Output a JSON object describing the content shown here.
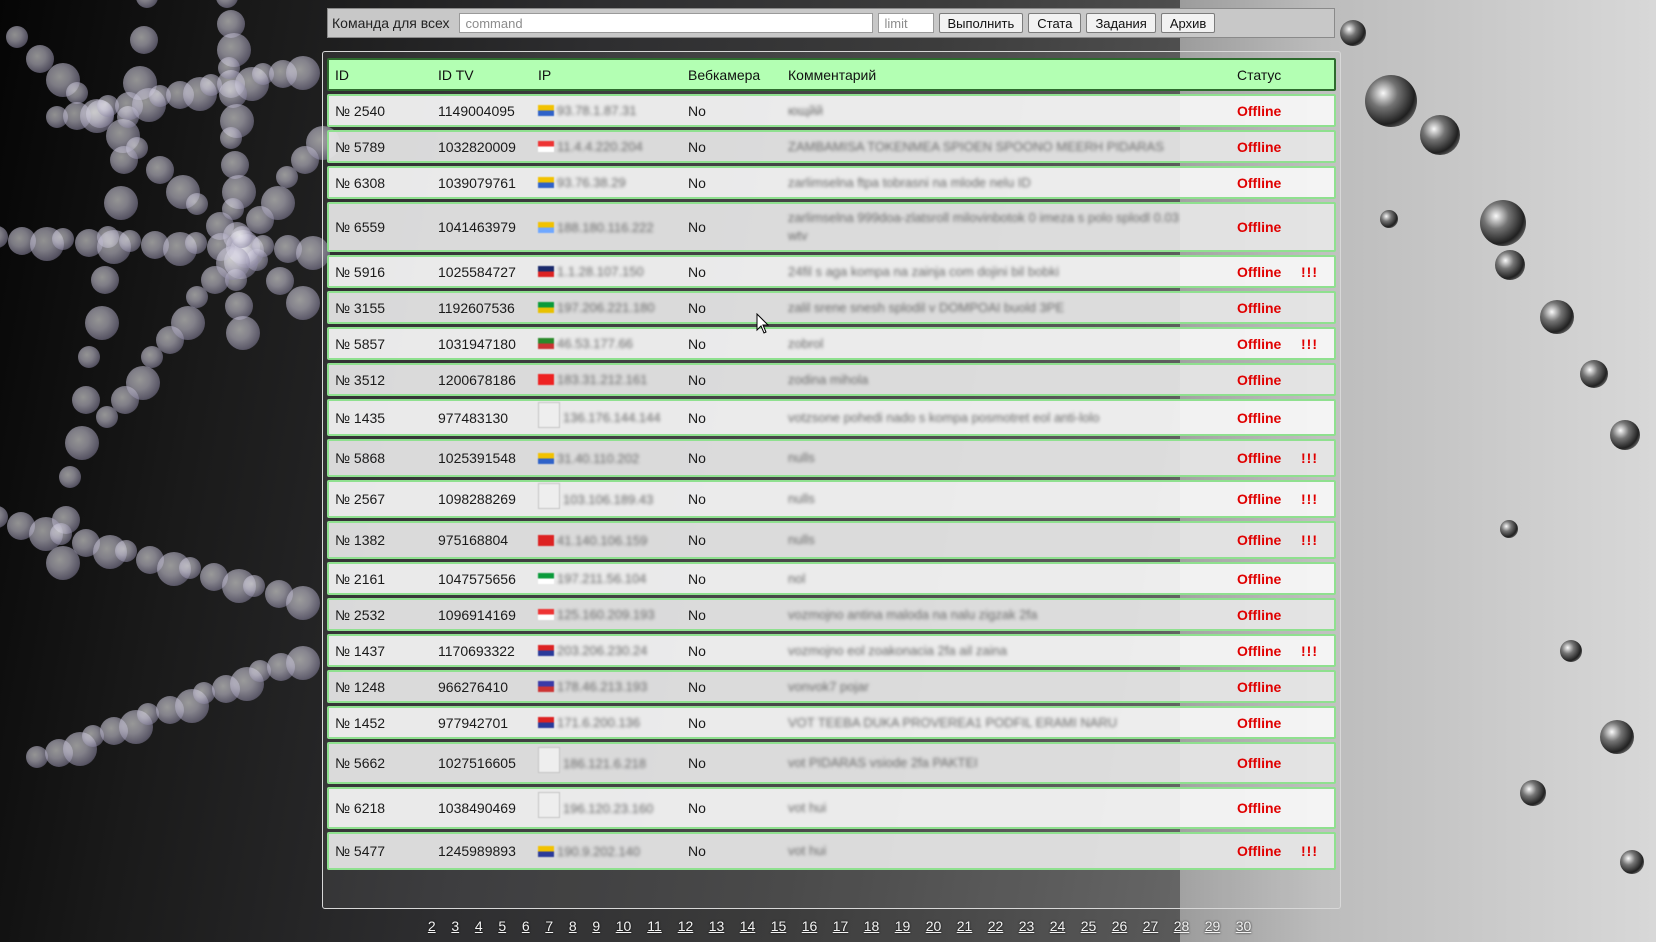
{
  "command_bar": {
    "label": "Команда для всех",
    "command_placeholder": "command",
    "limit_placeholder": "limit",
    "buttons": [
      "Выполнить",
      "Стата",
      "Задания",
      "Архив"
    ]
  },
  "table": {
    "headers": [
      "ID",
      "ID TV",
      "IP",
      "Вебкамера",
      "Комментарий",
      "Статус"
    ],
    "rows": [
      {
        "id": "№ 2540",
        "tv": "1149004095",
        "ip": "93.78.1.87.31",
        "flag": "#f2c200,#2f62c9",
        "cam": "No",
        "comment": "ющйй",
        "status": "Offline",
        "warn": ""
      },
      {
        "id": "№ 5789",
        "tv": "1032820009",
        "ip": "11.4.4.220.204",
        "flag": "#e33,#fff",
        "cam": "No",
        "comment": "ZAMBAMISA TOKENMEA SPIOEN SPOONO MEERH PIDARAS",
        "status": "Offline",
        "warn": ""
      },
      {
        "id": "№ 6308",
        "tv": "1039079761",
        "ip": "93.76.38.29",
        "flag": "#f2c200,#2f62c9",
        "cam": "No",
        "comment": "zarlimselna ftpa tobrasni na mlode nelu ID",
        "status": "Offline",
        "warn": ""
      },
      {
        "id": "№ 6559",
        "tv": "1041463979",
        "ip": "188.180.116.222",
        "flag": "#f2c200,#6fa8ff",
        "cam": "No",
        "comment": "zarlimselna 999doa-zlatsroll milovinbotok 0 imeza s polo splodl 0.03 wtv",
        "status": "Offline",
        "warn": "",
        "tall": true
      },
      {
        "id": "№ 5916",
        "tv": "1025584727",
        "ip": "1.1.28.107.150",
        "flag": "#1a2a6c,#d22",
        "cam": "No",
        "comment": "24fil s aga kompa na zainja com dojini bil bobki",
        "status": "Offline",
        "warn": "!!!"
      },
      {
        "id": "№ 3155",
        "tv": "1192607536",
        "ip": "197.206.221.180",
        "flag": "#0a9a3a,#e8c100",
        "cam": "No",
        "comment": "zalil srene snesh splodil v DOMPOAI buold 3PE",
        "status": "Offline",
        "warn": ""
      },
      {
        "id": "№ 5857",
        "tv": "1031947180",
        "ip": "46.53.177.66",
        "flag": "#2a8a2a,#c33",
        "cam": "No",
        "comment": "zobrol",
        "status": "Offline",
        "warn": "!!!"
      },
      {
        "id": "№ 3512",
        "tv": "1200678186",
        "ip": "183.31.212.161",
        "flag": "#e22,#e22",
        "cam": "No",
        "comment": "zodina mihola",
        "status": "Offline",
        "warn": ""
      },
      {
        "id": "№ 1435",
        "tv": "977483130",
        "ip": "136.176.144.144",
        "flag": "blank",
        "cam": "No",
        "comment": "votzsone pohedi nado s kompa posmotret eol anti-lolo",
        "status": "Offline",
        "warn": "",
        "tall": true
      },
      {
        "id": "№ 5868",
        "tv": "1025391548",
        "ip": "31.40.110.202",
        "flag": "#f2c200,#2f62c9",
        "cam": "No",
        "comment": "nulls",
        "status": "Offline",
        "warn": "!!!",
        "tall": true
      },
      {
        "id": "№ 2567",
        "tv": "1098288269",
        "ip": "103.106.189.43",
        "flag": "blank",
        "cam": "No",
        "comment": "nulls",
        "status": "Offline",
        "warn": "!!!",
        "tall": true
      },
      {
        "id": "№ 1382",
        "tv": "975168804",
        "ip": "41.140.106.159",
        "flag": "#d22,#d22",
        "cam": "No",
        "comment": "nulls",
        "status": "Offline",
        "warn": "!!!",
        "tall": true
      },
      {
        "id": "№ 2161",
        "tv": "1047575656",
        "ip": "197.211.56.104",
        "flag": "#0a9a3a,#fff",
        "cam": "No",
        "comment": "nol",
        "status": "Offline",
        "warn": ""
      },
      {
        "id": "№ 2532",
        "tv": "1096914169",
        "ip": "125.160.209.193",
        "flag": "#e33,#fff",
        "cam": "No",
        "comment": "vozmojno antina maloda na nalu zigzak 2fa",
        "status": "Offline",
        "warn": ""
      },
      {
        "id": "№ 1437",
        "tv": "1170693322",
        "ip": "203.206.230.24",
        "flag": "#d22,#2a3a9a",
        "cam": "No",
        "comment": "vozmojno eol zoakonacia 2fa ail zaina",
        "status": "Offline",
        "warn": "!!!"
      },
      {
        "id": "№ 1248",
        "tv": "966276410",
        "ip": "178.46.213.193",
        "flag": "#3a3aa8,#c33",
        "cam": "No",
        "comment": "vonvok7 pojar",
        "status": "Offline",
        "warn": ""
      },
      {
        "id": "№ 1452",
        "tv": "977942701",
        "ip": "171.6.200.136",
        "flag": "#d22,#2a3a9a",
        "cam": "No",
        "comment": "VOT TEEBA DUKA PROVEREA1 PODFIL ERAMI NARU",
        "status": "Offline",
        "warn": ""
      },
      {
        "id": "№ 5662",
        "tv": "1027516605",
        "ip": "186.121.6.218",
        "flag": "blank",
        "cam": "No",
        "comment": "vot PIDARAS vsiode 2fa PAKTEI",
        "status": "Offline",
        "warn": "",
        "tall": true
      },
      {
        "id": "№ 6218",
        "tv": "1038490469",
        "ip": "196.120.23.160",
        "flag": "blank",
        "cam": "No",
        "comment": "vot hui",
        "status": "Offline",
        "warn": "",
        "tall": true
      },
      {
        "id": "№ 5477",
        "tv": "1245989893",
        "ip": "190.9.202.140",
        "flag": "#f2c200,#2a3a9a",
        "cam": "No",
        "comment": "vot hui",
        "status": "Offline",
        "warn": "!!!",
        "tall": true
      }
    ]
  },
  "pagination": [
    "2",
    "3",
    "4",
    "5",
    "6",
    "7",
    "8",
    "9",
    "10",
    "11",
    "12",
    "13",
    "14",
    "15",
    "16",
    "17",
    "18",
    "19",
    "20",
    "21",
    "22",
    "23",
    "24",
    "25",
    "26",
    "27",
    "28",
    "29",
    "30"
  ],
  "colors": {
    "header_bg": "#b3ffb3",
    "row_border": "#8fe08f",
    "status": "#e00000"
  }
}
